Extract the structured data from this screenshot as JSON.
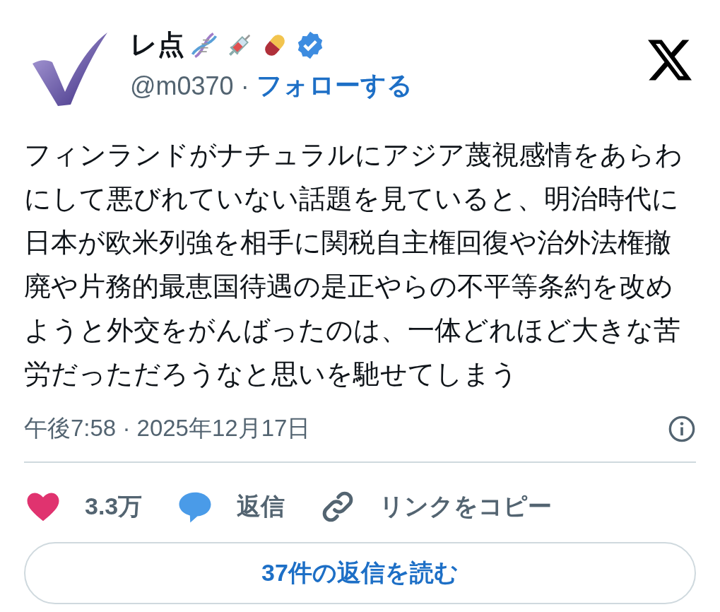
{
  "author": {
    "name": "レ点",
    "handle": "@m0370",
    "separator": "·",
    "follow": "フォローする",
    "verified": true
  },
  "body": "フィンランドがナチュラルにアジア蔑視感情をあらわにして悪びれていない話題を見ていると、明治時代に日本が欧米列強を相手に関税自主権回復や治外法権撤廃や片務的最恵国待遇の是正やらの不平等条約を改めようと外交をがんばったのは、一体どれほど大きな苦労だっただろうなと思いを馳せてしまう",
  "timestamp": "午後7:58 · 2025年12月17日",
  "actions": [
    {
      "kind": "like",
      "label": "3.3万"
    },
    {
      "kind": "reply",
      "label": "返信"
    },
    {
      "kind": "link",
      "label": "リンクをコピー"
    }
  ],
  "read_replies": "37件の返信を読む"
}
